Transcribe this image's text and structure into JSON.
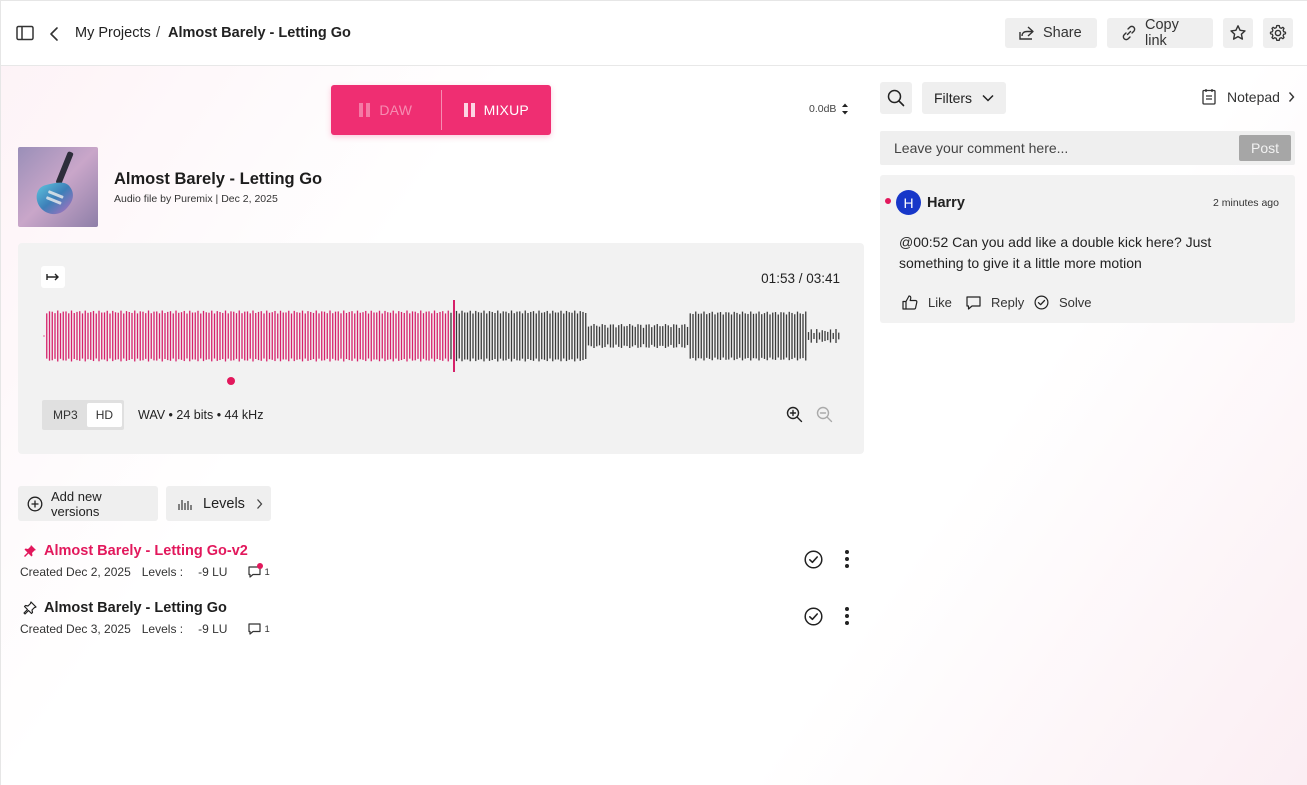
{
  "breadcrumb": {
    "root": "My Projects",
    "separator": "/",
    "current": "Almost Barely - Letting Go"
  },
  "header": {
    "share_label": "Share",
    "copy_link_label": "Copy link"
  },
  "mode_switch": {
    "daw": "DAW",
    "mixup": "MIXUP",
    "active": "MIXUP"
  },
  "gain": "0.0dB",
  "track": {
    "title": "Almost Barely - Letting Go",
    "meta": "Audio file by Puremix  |  Dec 2, 2025"
  },
  "player": {
    "time": "01:53 / 03:41",
    "progress": 0.51,
    "comment_marker_time": "00:52",
    "formats": [
      "MP3",
      "HD"
    ],
    "active_format": "HD",
    "format_info": "WAV • 24 bits  • 44 kHz"
  },
  "actions": {
    "add_versions": "Add new versions",
    "levels": "Levels"
  },
  "versions": [
    {
      "title": "Almost Barely - Letting Go-v2",
      "created": "Created Dec 2, 2025",
      "levels_label": "Levels :",
      "levels_value": "-9 LU",
      "comments": "1",
      "pinned": true,
      "unread": true
    },
    {
      "title": "Almost Barely - Letting Go",
      "created": "Created Dec 3, 2025",
      "levels_label": "Levels :",
      "levels_value": "-9 LU",
      "comments": "1",
      "pinned": false,
      "unread": false
    }
  ],
  "right_panel": {
    "filters_label": "Filters",
    "notepad_label": "Notepad",
    "comment_placeholder": "Leave your comment here...",
    "post_label": "Post"
  },
  "comments": [
    {
      "initial": "H",
      "author": "Harry",
      "time": "2 minutes ago",
      "body": "@00:52  Can you add like a double kick here? Just something to give it a little more motion",
      "actions": {
        "like": "Like",
        "reply": "Reply",
        "solve": "Solve"
      }
    }
  ],
  "colors": {
    "accent": "#ef2e72",
    "played_wave": "#d6216a",
    "wave": "#3a3a3a",
    "avatar": "#1737c9"
  }
}
